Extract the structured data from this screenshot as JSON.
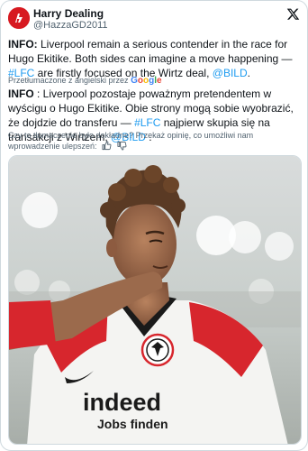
{
  "author": {
    "display_name": "Harry Dealing",
    "handle": "@HazzaGD2011",
    "avatar_color": "#d71920"
  },
  "tweet": {
    "lead": "INFO:",
    "text_1": " Liverpool remain a serious contender in the race for Hugo Ekitike. Both sides can imagine a move happening — ",
    "hashtag_1": "#LFC",
    "text_2": " are firstly focused on the Wirtz deal, ",
    "mention_1": "@BILD",
    "text_3": "."
  },
  "translation": {
    "label": "Przetłumaczone z angielski przez",
    "provider": "Google",
    "lead": "INFO",
    "text_1": " : Liverpool pozostaje poważnym pretendentem w wyścigu o Hugo Ekitike. Obie strony mogą sobie wyobrazić, że dojdzie do transferu — ",
    "hashtag_1": "#LFC",
    "text_2": " najpierw skupia się na transakcji z Wirtzem, ",
    "mention_1": "@BILD",
    "text_3": " ."
  },
  "feedback": {
    "prompt": "Czy to tłumaczenie było dokładne? Przekaż opinię, co umożliwi nam wprowadzenie ulepszeń:"
  },
  "media": {
    "sponsor_line_1": "indeed",
    "sponsor_line_2": "Jobs finden",
    "shirt_color": "#ffffff",
    "sleeve_color": "#d7262d"
  },
  "colors": {
    "link": "#1d9bf0",
    "secondary_text": "#536471",
    "border": "#cfd9de"
  }
}
